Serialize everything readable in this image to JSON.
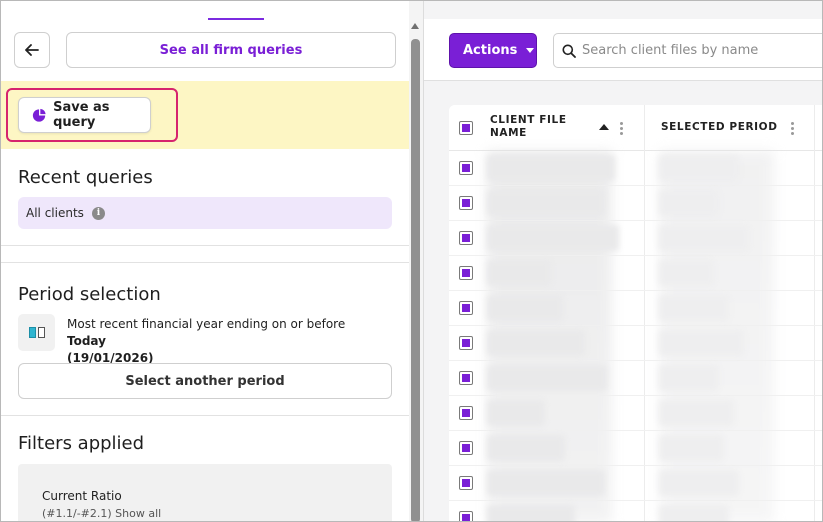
{
  "left_panel": {
    "back_button_label": "←",
    "see_all_label": "See all firm queries",
    "save_as_query_label": "Save as query",
    "recent_queries_title": "Recent queries",
    "recent_chip_label": "All clients",
    "period_title": "Period selection",
    "period_text_prefix": "Most recent financial year ending on or before ",
    "period_text_bold": "Today",
    "period_text_date": "(19/01/2026)",
    "select_period_label": "Select another period",
    "filters_title": "Filters applied",
    "filter_name": "Current Ratio",
    "filter_meta": "(#1.1/-#2.1) Show all"
  },
  "right_panel": {
    "actions_label": "Actions",
    "search_placeholder": "Search client files by name",
    "columns": [
      "CLIENT FILE NAME",
      "SELECTED PERIOD"
    ],
    "row_count": 11
  },
  "colors": {
    "accent": "#7a1fd6",
    "highlight": "#d6246e",
    "save_strip": "#fdf6c4",
    "chip_bg": "#efe7fb"
  },
  "icons": {
    "back": "arrow-left-icon",
    "save_query": "pie-chart-icon",
    "info": "info-icon",
    "period": "calendar-period-icon",
    "actions_dropdown": "caret-down-icon",
    "search": "search-icon",
    "sort": "sort-ascending-icon",
    "column_menu": "kebab-menu-icon"
  }
}
